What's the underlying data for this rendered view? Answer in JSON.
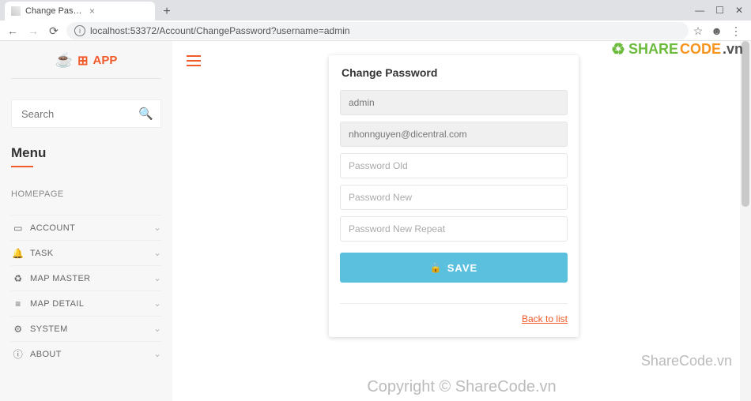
{
  "browser": {
    "tab_title": "Change Password Page - Custon",
    "url": "localhost:53372/Account/ChangePassword?username=admin"
  },
  "sidebar": {
    "app_name": "APP",
    "search_placeholder": "Search",
    "menu_heading": "Menu",
    "homepage_label": "HOMEPAGE",
    "items": [
      {
        "icon": "▭",
        "label": "ACCOUNT"
      },
      {
        "icon": "🔔",
        "label": "TASK"
      },
      {
        "icon": "♻",
        "label": "MAP MASTER"
      },
      {
        "icon": "≡",
        "label": "MAP DETAIL"
      },
      {
        "icon": "⚙",
        "label": "SYSTEM"
      },
      {
        "icon": "ⓘ",
        "label": "ABOUT"
      }
    ]
  },
  "card": {
    "title": "Change Password",
    "username": "admin",
    "email": "nhonnguyen@dicentral.com",
    "old_placeholder": "Password Old",
    "new_placeholder": "Password New",
    "repeat_placeholder": "Password New Repeat",
    "save_label": "SAVE",
    "back_label": "Back to list"
  },
  "watermark": {
    "brand_share": "SHARE",
    "brand_code": "CODE",
    "brand_tld": ".vn",
    "side": "ShareCode.vn",
    "center": "Copyright © ShareCode.vn"
  }
}
